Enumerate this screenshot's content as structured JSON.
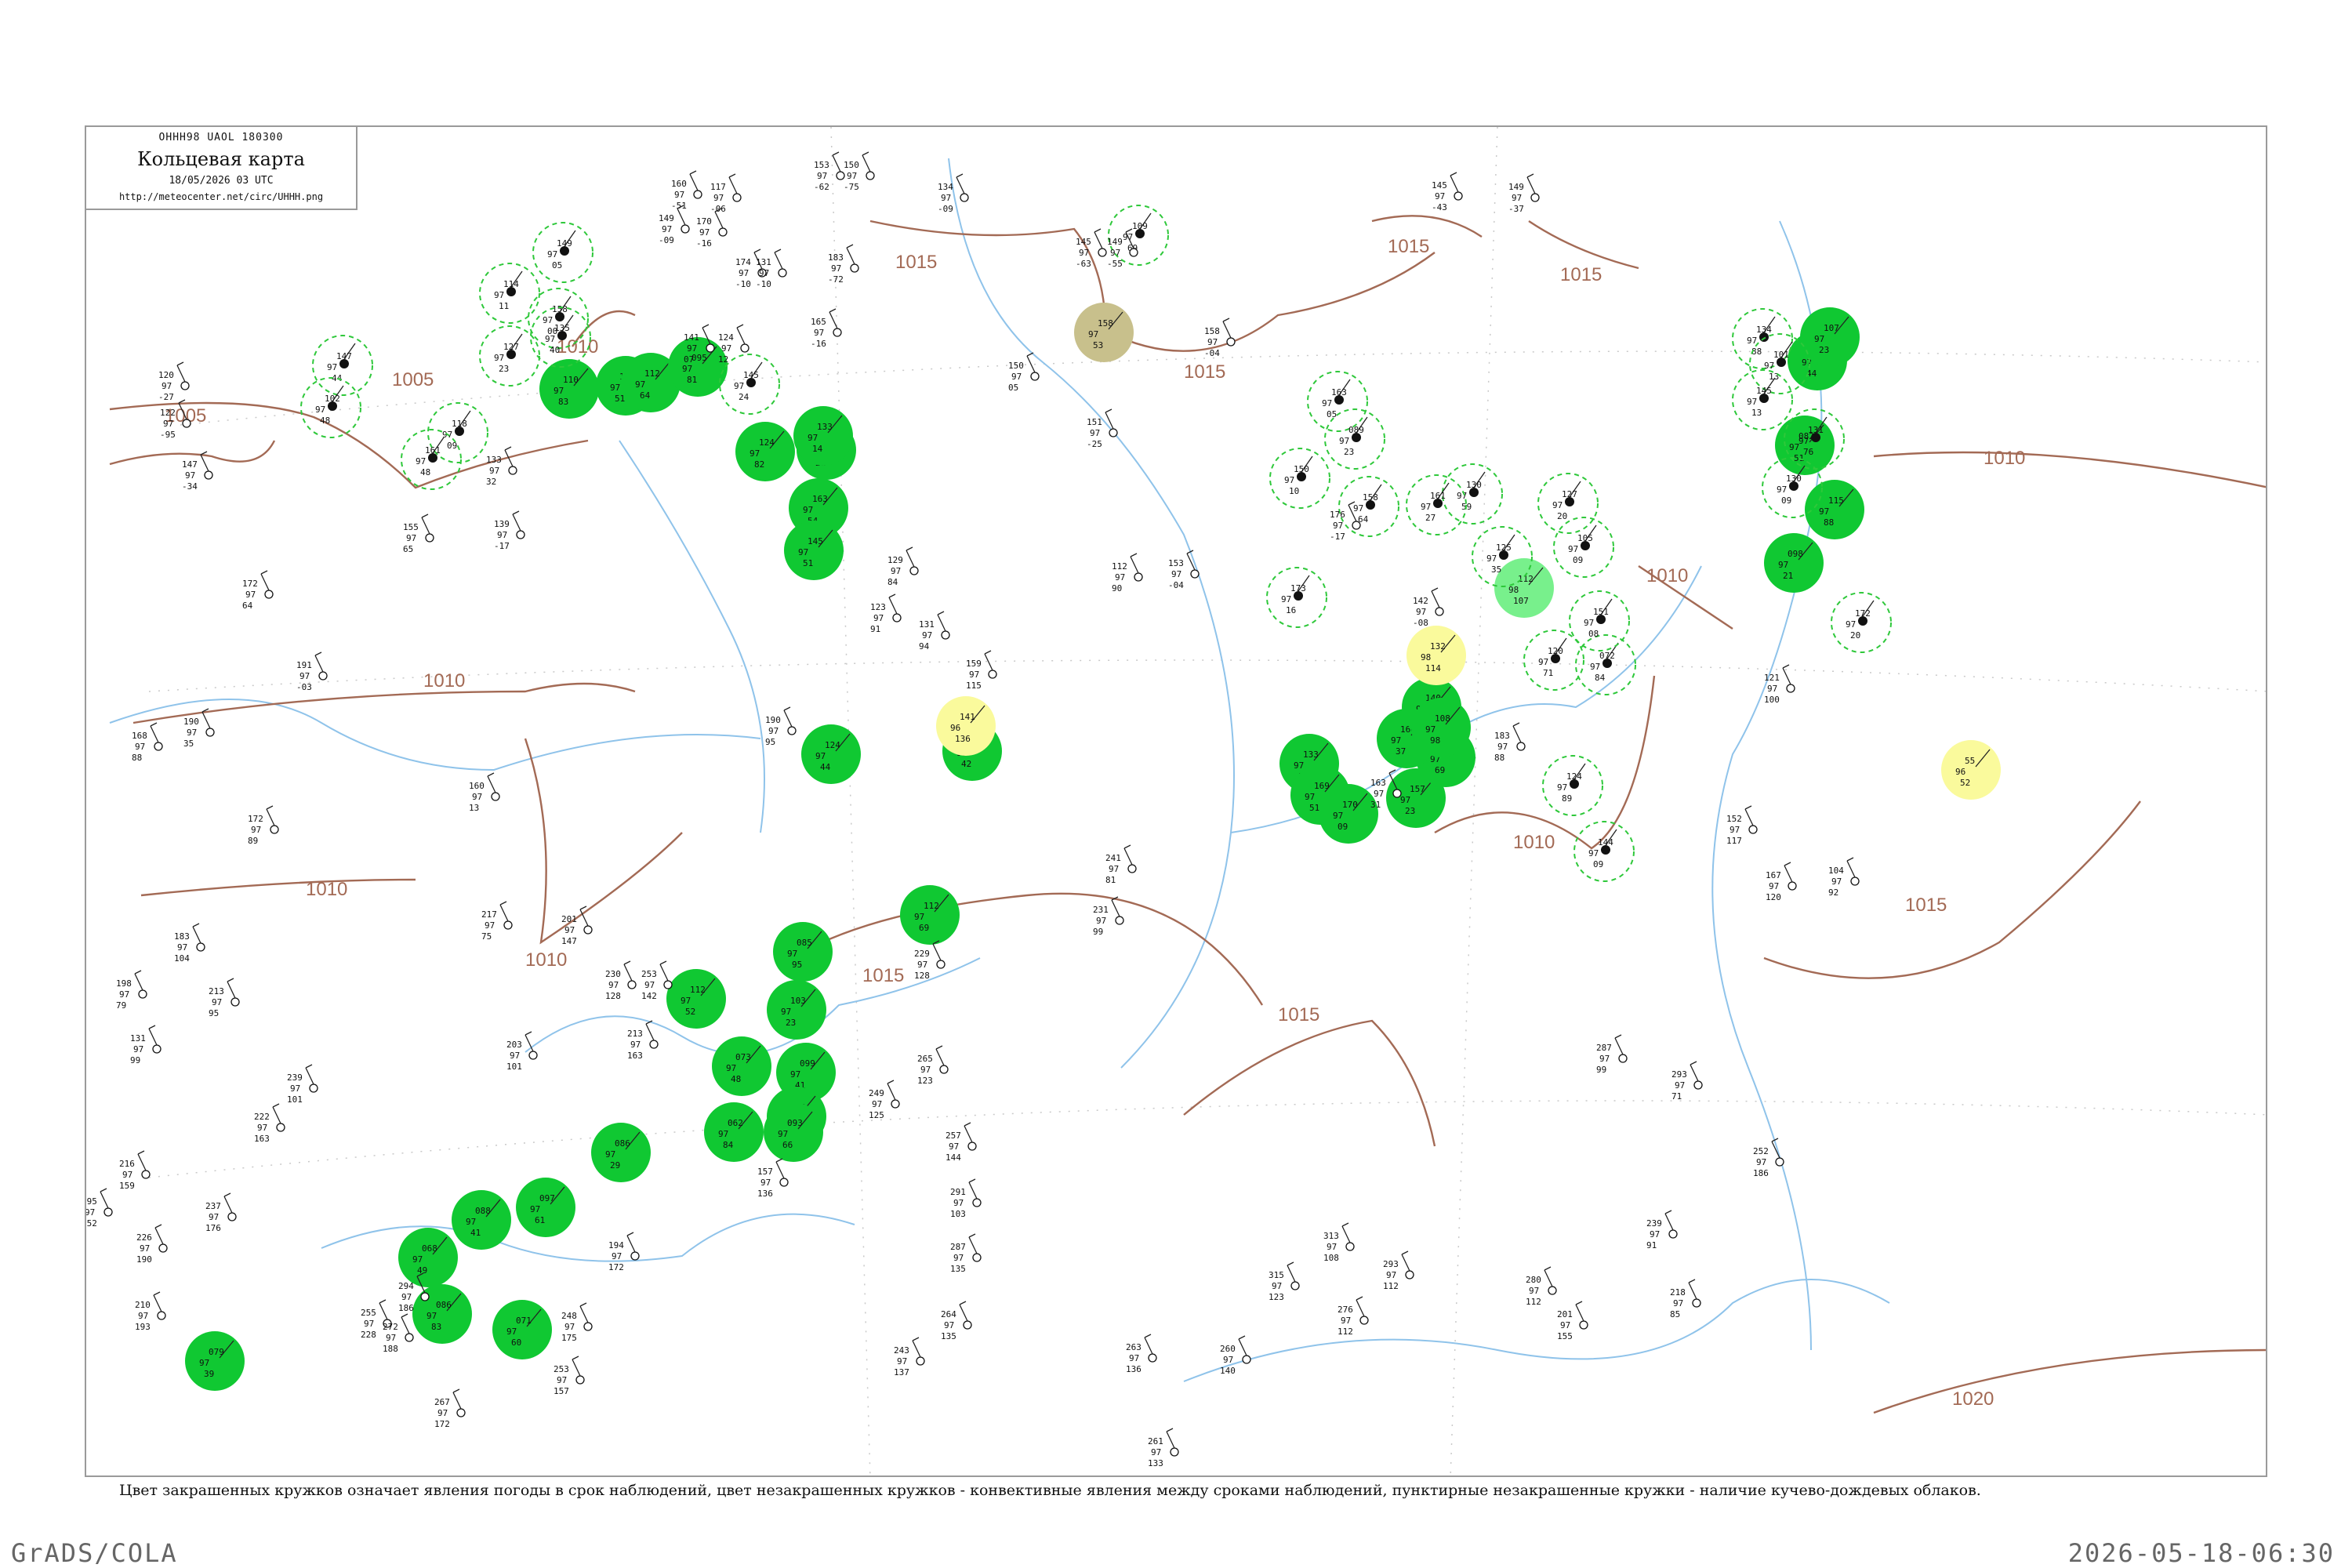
{
  "header": {
    "code": "ОННН98  UAOL  180300",
    "title": "Кольцевая карта",
    "datetime": "18/05/2026 03 UTC",
    "url": "http://meteocenter.net/circ/UHHH.png"
  },
  "caption": "Цвет закрашенных кружков означает явления погоды в срок наблюдений, цвет незакрашенных кружков - конвективные явления между сроками наблюдений, пунктирные незакрашенные кружки - наличие кучево-дождевых облаков.",
  "footer": {
    "left": "GrADS/COLA",
    "right": "2026-05-18-06:30"
  },
  "colors": {
    "filled_rain": "#10c832",
    "filled_fog": "#fafa9c",
    "filled_haze": "#c8c08c",
    "filled_drizzle": "#78f08c",
    "convective_ring": "#2ec83a",
    "isobar": "#a36a55",
    "river": "#8fc3ea"
  },
  "isobars": [
    {
      "label": "1005"
    },
    {
      "label": "1005"
    },
    {
      "label": "1010"
    },
    {
      "label": "1010"
    },
    {
      "label": "1010"
    },
    {
      "label": "1010"
    },
    {
      "label": "1015"
    },
    {
      "label": "1015"
    },
    {
      "label": "1015"
    },
    {
      "label": "1015"
    },
    {
      "label": "1015"
    },
    {
      "label": "1015"
    },
    {
      "label": "1010"
    },
    {
      "label": "1010"
    },
    {
      "label": "1010"
    },
    {
      "label": "1015"
    },
    {
      "label": "1020"
    }
  ],
  "stations": [
    {
      "kind": "filled",
      "color": "filled_rain",
      "v1": "110",
      "v2": "97",
      "v3": "83"
    },
    {
      "kind": "filled",
      "color": "filled_rain",
      "v1": "125",
      "v2": "97",
      "v3": "51"
    },
    {
      "kind": "filled",
      "color": "filled_rain",
      "v1": "112",
      "v2": "97",
      "v3": "64"
    },
    {
      "kind": "filled",
      "color": "filled_rain",
      "v1": "095",
      "v2": "97",
      "v3": "81"
    },
    {
      "kind": "filled",
      "color": "filled_rain",
      "v1": "142",
      "v2": "97",
      "v3": "21"
    },
    {
      "kind": "filled",
      "color": "filled_rain",
      "v1": "124",
      "v2": "97",
      "v3": "82"
    },
    {
      "kind": "filled",
      "color": "filled_rain",
      "v1": "133",
      "v2": "97",
      "v3": "14"
    },
    {
      "kind": "filled",
      "color": "filled_rain",
      "v1": "163",
      "v2": "97",
      "v3": "54"
    },
    {
      "kind": "filled",
      "color": "filled_rain",
      "v1": "145",
      "v2": "97",
      "v3": "51"
    },
    {
      "kind": "filled",
      "color": "filled_rain",
      "v1": "112",
      "v2": "97",
      "v3": "69"
    },
    {
      "kind": "filled",
      "color": "filled_rain",
      "v1": "085",
      "v2": "97",
      "v3": "95"
    },
    {
      "kind": "filled",
      "color": "filled_rain",
      "v1": "112",
      "v2": "97",
      "v3": "52"
    },
    {
      "kind": "filled",
      "color": "filled_rain",
      "v1": "103",
      "v2": "97",
      "v3": "23"
    },
    {
      "kind": "filled",
      "color": "filled_rain",
      "v1": "099",
      "v2": "97",
      "v3": "41"
    },
    {
      "kind": "filled",
      "color": "filled_rain",
      "v1": "082",
      "v2": "97",
      "v3": "87"
    },
    {
      "kind": "filled",
      "color": "filled_rain",
      "v1": "093",
      "v2": "97",
      "v3": "66"
    },
    {
      "kind": "filled",
      "color": "filled_rain",
      "v1": "062",
      "v2": "97",
      "v3": "84"
    },
    {
      "kind": "filled",
      "color": "filled_rain",
      "v1": "073",
      "v2": "97",
      "v3": "48"
    },
    {
      "kind": "filled",
      "color": "filled_rain",
      "v1": "086",
      "v2": "97",
      "v3": "29"
    },
    {
      "kind": "filled",
      "color": "filled_rain",
      "v1": "097",
      "v2": "97",
      "v3": "61"
    },
    {
      "kind": "filled",
      "color": "filled_rain",
      "v1": "088",
      "v2": "97",
      "v3": "41"
    },
    {
      "kind": "filled",
      "color": "filled_rain",
      "v1": "068",
      "v2": "97",
      "v3": "49"
    },
    {
      "kind": "filled",
      "color": "filled_rain",
      "v1": "086",
      "v2": "97",
      "v3": "83"
    },
    {
      "kind": "filled",
      "color": "filled_rain",
      "v1": "071",
      "v2": "97",
      "v3": "60"
    },
    {
      "kind": "filled",
      "color": "filled_rain",
      "v1": "079",
      "v2": "97",
      "v3": "39"
    },
    {
      "kind": "filled",
      "color": "filled_rain",
      "v1": "133",
      "v2": "97",
      "v3": "14"
    },
    {
      "kind": "filled",
      "color": "filled_rain",
      "v1": "169",
      "v2": "97",
      "v3": "51"
    },
    {
      "kind": "filled",
      "color": "filled_rain",
      "v1": "170",
      "v2": "97",
      "v3": "09"
    },
    {
      "kind": "filled",
      "color": "filled_rain",
      "v1": "157",
      "v2": "97",
      "v3": "23"
    },
    {
      "kind": "filled",
      "color": "filled_rain",
      "v1": "172",
      "v2": "97",
      "v3": "69"
    },
    {
      "kind": "filled",
      "color": "filled_rain",
      "v1": "166",
      "v2": "97",
      "v3": "37"
    },
    {
      "kind": "filled",
      "color": "filled_rain",
      "v1": "140",
      "v2": "97",
      "v3": "45"
    },
    {
      "kind": "filled",
      "color": "filled_rain",
      "v1": "108",
      "v2": "97",
      "v3": "98"
    },
    {
      "kind": "filled",
      "color": "filled_rain",
      "v1": "098",
      "v2": "97",
      "v3": "21"
    },
    {
      "kind": "filled",
      "color": "filled_rain",
      "v1": "082",
      "v2": "97",
      "v3": "51"
    },
    {
      "kind": "filled",
      "color": "filled_rain",
      "v1": "092",
      "v2": "97",
      "v3": "44"
    },
    {
      "kind": "filled",
      "color": "filled_rain",
      "v1": "107",
      "v2": "97",
      "v3": "23"
    },
    {
      "kind": "filled",
      "color": "filled_rain",
      "v1": "115",
      "v2": "97",
      "v3": "88"
    },
    {
      "kind": "filled",
      "color": "filled_rain",
      "v1": "124",
      "v2": "97",
      "v3": "44"
    },
    {
      "kind": "filled",
      "color": "filled_rain",
      "v1": "134",
      "v2": "97",
      "v3": "42"
    },
    {
      "kind": "filled",
      "color": "filled_fog",
      "v1": "141",
      "v2": "96",
      "v3": "136"
    },
    {
      "kind": "filled",
      "color": "filled_fog",
      "v1": "132",
      "v2": "98",
      "v3": "114"
    },
    {
      "kind": "filled",
      "color": "filled_fog",
      "v1": "55",
      "v2": "96",
      "v3": "52"
    },
    {
      "kind": "filled",
      "color": "filled_haze",
      "v1": "158",
      "v2": "97",
      "v3": "53"
    },
    {
      "kind": "filled",
      "color": "filled_drizzle",
      "v1": "112",
      "v2": "98",
      "v3": "107"
    },
    {
      "kind": "ring",
      "v1": "114",
      "v2": "97",
      "v3": "11"
    },
    {
      "kind": "ring",
      "v1": "149",
      "v2": "97",
      "v3": "05"
    },
    {
      "kind": "ring",
      "v1": "158",
      "v2": "97",
      "v3": "00"
    },
    {
      "kind": "ring",
      "v1": "127",
      "v2": "97",
      "v3": "23"
    },
    {
      "kind": "ring",
      "v1": "135",
      "v2": "97",
      "v3": "40"
    },
    {
      "kind": "ring",
      "v1": "147",
      "v2": "97",
      "v3": "44"
    },
    {
      "kind": "ring",
      "v1": "102",
      "v2": "97",
      "v3": "48"
    },
    {
      "kind": "ring",
      "v1": "118",
      "v2": "97",
      "v3": "09"
    },
    {
      "kind": "ring",
      "v1": "161",
      "v2": "97",
      "v3": "48"
    },
    {
      "kind": "ring",
      "v1": "145",
      "v2": "97",
      "v3": "24"
    },
    {
      "kind": "ring",
      "v1": "109",
      "v2": "97",
      "v3": "69"
    },
    {
      "kind": "ring",
      "v1": "150",
      "v2": "97",
      "v3": "10"
    },
    {
      "kind": "ring",
      "v1": "163",
      "v2": "97",
      "v3": "05"
    },
    {
      "kind": "ring",
      "v1": "089",
      "v2": "97",
      "v3": "23"
    },
    {
      "kind": "ring",
      "v1": "173",
      "v2": "97",
      "v3": "16"
    },
    {
      "kind": "ring",
      "v1": "158",
      "v2": "97",
      "v3": "64"
    },
    {
      "kind": "ring",
      "v1": "130",
      "v2": "97",
      "v3": "59"
    },
    {
      "kind": "ring",
      "v1": "161",
      "v2": "97",
      "v3": "27"
    },
    {
      "kind": "ring",
      "v1": "127",
      "v2": "97",
      "v3": "20"
    },
    {
      "kind": "ring",
      "v1": "105",
      "v2": "97",
      "v3": "09"
    },
    {
      "kind": "ring",
      "v1": "120",
      "v2": "97",
      "v3": "71"
    },
    {
      "kind": "ring",
      "v1": "072",
      "v2": "97",
      "v3": "84"
    },
    {
      "kind": "ring",
      "v1": "124",
      "v2": "97",
      "v3": "89"
    },
    {
      "kind": "ring",
      "v1": "144",
      "v2": "97",
      "v3": "09"
    },
    {
      "kind": "ring",
      "v1": "151",
      "v2": "97",
      "v3": "08"
    },
    {
      "kind": "ring",
      "v1": "125",
      "v2": "97",
      "v3": "35"
    },
    {
      "kind": "ring",
      "v1": "134",
      "v2": "97",
      "v3": "88"
    },
    {
      "kind": "ring",
      "v1": "101",
      "v2": "97",
      "v3": "13"
    },
    {
      "kind": "ring",
      "v1": "145",
      "v2": "97",
      "v3": "13"
    },
    {
      "kind": "ring",
      "v1": "130",
      "v2": "97",
      "v3": "09"
    },
    {
      "kind": "ring",
      "v1": "131",
      "v2": "97",
      "v3": "76"
    },
    {
      "kind": "ring",
      "v1": "172",
      "v2": "97",
      "v3": "20"
    }
  ],
  "plain_stations": [
    {
      "v1": "153",
      "v2": "97",
      "v3": "-62"
    },
    {
      "v1": "150",
      "v2": "97",
      "v3": "-75"
    },
    {
      "v1": "134",
      "v2": "97",
      "v3": "-09"
    },
    {
      "v1": "183",
      "v2": "97",
      "v3": "-72"
    },
    {
      "v1": "145",
      "v2": "97",
      "v3": "-63"
    },
    {
      "v1": "149",
      "v2": "97",
      "v3": "-55"
    },
    {
      "v1": "145",
      "v2": "97",
      "v3": "-43"
    },
    {
      "v1": "149",
      "v2": "97",
      "v3": "-37"
    },
    {
      "v1": "160",
      "v2": "97",
      "v3": "-51"
    },
    {
      "v1": "117",
      "v2": "97",
      "v3": "-06"
    },
    {
      "v1": "149",
      "v2": "97",
      "v3": "-09"
    },
    {
      "v1": "170",
      "v2": "97",
      "v3": "-16"
    },
    {
      "v1": "174",
      "v2": "97",
      "v3": "-10"
    },
    {
      "v1": "131",
      "v2": "97",
      "v3": "-10"
    },
    {
      "v1": "165",
      "v2": "97",
      "v3": "-16"
    },
    {
      "v1": "141",
      "v2": "97",
      "v3": "07"
    },
    {
      "v1": "124",
      "v2": "97",
      "v3": "12"
    },
    {
      "v1": "158",
      "v2": "97",
      "v3": "-04"
    },
    {
      "v1": "120",
      "v2": "97",
      "v3": "-27"
    },
    {
      "v1": "122",
      "v2": "97",
      "v3": "-95"
    },
    {
      "v1": "147",
      "v2": "97",
      "v3": "-34"
    },
    {
      "v1": "150",
      "v2": "97",
      "v3": "05"
    },
    {
      "v1": "151",
      "v2": "97",
      "v3": "-25"
    },
    {
      "v1": "133",
      "v2": "97",
      "v3": "32"
    },
    {
      "v1": "155",
      "v2": "97",
      "v3": "65"
    },
    {
      "v1": "139",
      "v2": "97",
      "v3": "-17"
    },
    {
      "v1": "153",
      "v2": "97",
      "v3": "-04"
    },
    {
      "v1": "172",
      "v2": "97",
      "v3": "64"
    },
    {
      "v1": "191",
      "v2": "97",
      "v3": "-03"
    },
    {
      "v1": "190",
      "v2": "97",
      "v3": "35"
    },
    {
      "v1": "168",
      "v2": "97",
      "v3": "88"
    },
    {
      "v1": "172",
      "v2": "97",
      "v3": "89"
    },
    {
      "v1": "183",
      "v2": "97",
      "v3": "104"
    },
    {
      "v1": "198",
      "v2": "97",
      "v3": "79"
    },
    {
      "v1": "213",
      "v2": "97",
      "v3": "95"
    },
    {
      "v1": "131",
      "v2": "97",
      "v3": "99"
    },
    {
      "v1": "239",
      "v2": "97",
      "v3": "101"
    },
    {
      "v1": "222",
      "v2": "97",
      "v3": "163"
    },
    {
      "v1": "216",
      "v2": "97",
      "v3": "159"
    },
    {
      "v1": "195",
      "v2": "97",
      "v3": "152"
    },
    {
      "v1": "237",
      "v2": "97",
      "v3": "176"
    },
    {
      "v1": "226",
      "v2": "97",
      "v3": "190"
    },
    {
      "v1": "210",
      "v2": "97",
      "v3": "193"
    },
    {
      "v1": "255",
      "v2": "97",
      "v3": "228"
    },
    {
      "v1": "294",
      "v2": "97",
      "v3": "186"
    },
    {
      "v1": "272",
      "v2": "97",
      "v3": "188"
    },
    {
      "v1": "248",
      "v2": "97",
      "v3": "175"
    },
    {
      "v1": "253",
      "v2": "97",
      "v3": "157"
    },
    {
      "v1": "267",
      "v2": "97",
      "v3": "172"
    },
    {
      "v1": "194",
      "v2": "97",
      "v3": "172"
    },
    {
      "v1": "157",
      "v2": "97",
      "v3": "136"
    },
    {
      "v1": "190",
      "v2": "97",
      "v3": "95"
    },
    {
      "v1": "160",
      "v2": "97",
      "v3": "13"
    },
    {
      "v1": "217",
      "v2": "97",
      "v3": "75"
    },
    {
      "v1": "201",
      "v2": "97",
      "v3": "147"
    },
    {
      "v1": "230",
      "v2": "97",
      "v3": "128"
    },
    {
      "v1": "253",
      "v2": "97",
      "v3": "142"
    },
    {
      "v1": "213",
      "v2": "97",
      "v3": "163"
    },
    {
      "v1": "203",
      "v2": "97",
      "v3": "101"
    },
    {
      "v1": "129",
      "v2": "97",
      "v3": "84"
    },
    {
      "v1": "123",
      "v2": "97",
      "v3": "91"
    },
    {
      "v1": "131",
      "v2": "97",
      "v3": "94"
    },
    {
      "v1": "159",
      "v2": "97",
      "v3": "115"
    },
    {
      "v1": "112",
      "v2": "97",
      "v3": "90"
    },
    {
      "v1": "241",
      "v2": "97",
      "v3": "81"
    },
    {
      "v1": "231",
      "v2": "97",
      "v3": "99"
    },
    {
      "v1": "229",
      "v2": "97",
      "v3": "128"
    },
    {
      "v1": "265",
      "v2": "97",
      "v3": "123"
    },
    {
      "v1": "249",
      "v2": "97",
      "v3": "125"
    },
    {
      "v1": "257",
      "v2": "97",
      "v3": "144"
    },
    {
      "v1": "291",
      "v2": "97",
      "v3": "103"
    },
    {
      "v1": "287",
      "v2": "97",
      "v3": "135"
    },
    {
      "v1": "264",
      "v2": "97",
      "v3": "135"
    },
    {
      "v1": "243",
      "v2": "97",
      "v3": "137"
    },
    {
      "v1": "263",
      "v2": "97",
      "v3": "136"
    },
    {
      "v1": "261",
      "v2": "97",
      "v3": "133"
    },
    {
      "v1": "260",
      "v2": "97",
      "v3": "140"
    },
    {
      "v1": "315",
      "v2": "97",
      "v3": "123"
    },
    {
      "v1": "276",
      "v2": "97",
      "v3": "112"
    },
    {
      "v1": "313",
      "v2": "97",
      "v3": "108"
    },
    {
      "v1": "293",
      "v2": "97",
      "v3": "112"
    },
    {
      "v1": "280",
      "v2": "97",
      "v3": "112"
    },
    {
      "v1": "201",
      "v2": "97",
      "v3": "155"
    },
    {
      "v1": "218",
      "v2": "97",
      "v3": "85"
    },
    {
      "v1": "239",
      "v2": "97",
      "v3": "91"
    },
    {
      "v1": "293",
      "v2": "97",
      "v3": "71"
    },
    {
      "v1": "287",
      "v2": "97",
      "v3": "99"
    },
    {
      "v1": "252",
      "v2": "97",
      "v3": "186"
    },
    {
      "v1": "163",
      "v2": "97",
      "v3": "31"
    },
    {
      "v1": "183",
      "v2": "97",
      "v3": "88"
    },
    {
      "v1": "176",
      "v2": "97",
      "v3": "-17"
    },
    {
      "v1": "142",
      "v2": "97",
      "v3": "-08"
    },
    {
      "v1": "121",
      "v2": "97",
      "v3": "100"
    },
    {
      "v1": "152",
      "v2": "97",
      "v3": "117"
    },
    {
      "v1": "167",
      "v2": "97",
      "v3": "120"
    },
    {
      "v1": "104",
      "v2": "97",
      "v3": "92"
    }
  ]
}
